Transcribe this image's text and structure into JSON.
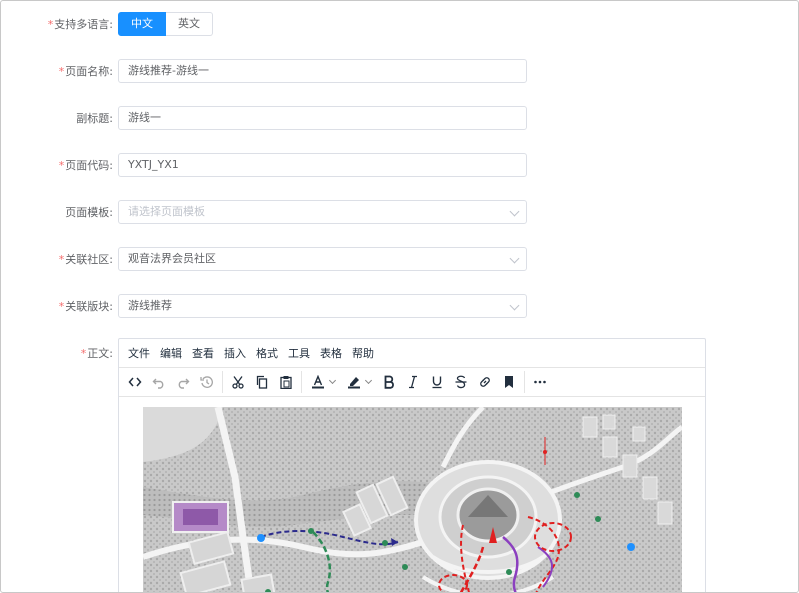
{
  "form": {
    "language": {
      "label": "支持多语言:",
      "required": true,
      "options": [
        "中文",
        "英文"
      ],
      "selected": "中文"
    },
    "page_name": {
      "label": "页面名称:",
      "required": true,
      "value": "游线推荐-游线一"
    },
    "subtitle": {
      "label": "副标题:",
      "required": false,
      "value": "游线一"
    },
    "page_code": {
      "label": "页面代码:",
      "required": true,
      "value": "YXTJ_YX1"
    },
    "page_template": {
      "label": "页面模板:",
      "required": false,
      "placeholder": "请选择页面模板"
    },
    "community": {
      "label": "关联社区:",
      "required": true,
      "value": "观音法界会员社区"
    },
    "section": {
      "label": "关联版块:",
      "required": true,
      "value": "游线推荐"
    },
    "body": {
      "label": "正文:",
      "required": true
    }
  },
  "editor": {
    "menu": [
      "文件",
      "编辑",
      "查看",
      "插入",
      "格式",
      "工具",
      "表格",
      "帮助"
    ],
    "toolbar_icons": [
      "source-code-icon",
      "undo-icon",
      "redo-icon",
      "history-icon",
      "cut-icon",
      "copy-icon",
      "paste-icon",
      "text-color-icon",
      "highlight-color-icon",
      "bold-icon",
      "italic-icon",
      "underline-icon",
      "strikethrough-icon",
      "link-icon",
      "bookmark-icon",
      "more-icon"
    ]
  },
  "colors": {
    "primary": "#1890ff",
    "required": "#f56c6c",
    "border": "#dcdfe6"
  }
}
